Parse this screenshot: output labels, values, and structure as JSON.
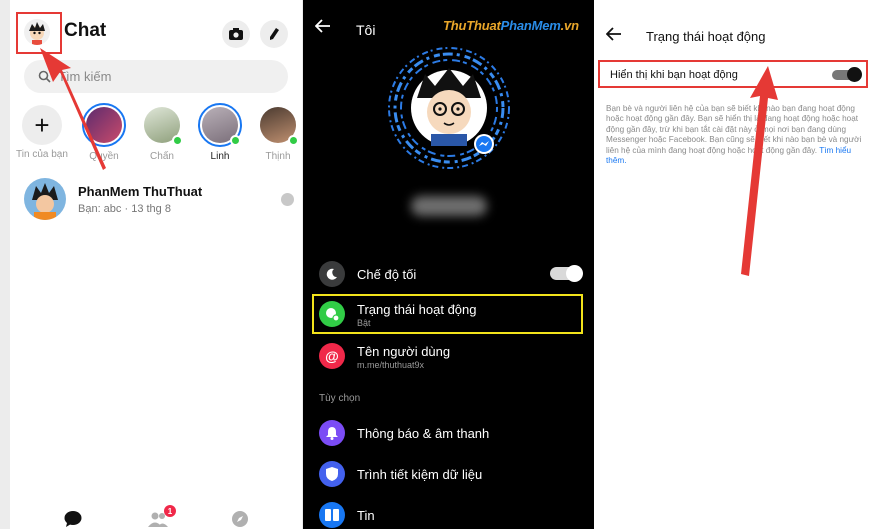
{
  "panel1": {
    "title": "Chat",
    "search_placeholder": "Tìm kiếm",
    "add_story_label": "Tin của bạn",
    "stories": [
      {
        "name": "Quyền",
        "active": false
      },
      {
        "name": "Chấn",
        "active": false
      },
      {
        "name": "Linh",
        "active": true
      },
      {
        "name": "Thịnh",
        "active": false
      }
    ],
    "conversation": {
      "name": "PhanMem ThuThuat",
      "subtitle": "Bạn: abc · 13 thg 8"
    },
    "nav_badge": "1",
    "icons": [
      "camera-icon",
      "pencil-icon",
      "search-icon",
      "plus-icon",
      "chat-bubble-icon",
      "people-icon",
      "compass-icon"
    ]
  },
  "panel2": {
    "title": "Tôi",
    "watermark_a": "ThuThuat",
    "watermark_b": "PhanMem",
    "watermark_c": ".vn",
    "rows": [
      {
        "label": "Chế độ tối",
        "sub": ""
      },
      {
        "label": "Trạng thái hoạt động",
        "sub": "Bật"
      },
      {
        "label": "Tên người dùng",
        "sub": "m.me/thuthuat9x"
      }
    ],
    "section": "Tùy chọn",
    "options": [
      {
        "label": "Thông báo & âm thanh"
      },
      {
        "label": "Trình tiết kiệm dữ liệu"
      },
      {
        "label": "Tin"
      }
    ],
    "colors": {
      "active_status": "#31cc46",
      "username": "#f02849",
      "notifications": "#7b4cf5",
      "data_saver": "#4361ee",
      "stories": "#1877f2"
    }
  },
  "panel3": {
    "title": "Trạng thái hoạt động",
    "toggle_label": "Hiển thị khi bạn hoạt động",
    "description": "Bạn bè và người liên hệ của bạn sẽ biết khi nào bạn đang hoạt động hoặc hoạt động gần đây. Bạn sẽ hiển thị là đang hoạt động hoặc hoạt động gần đây, trừ khi bạn tắt cài đặt này ở mọi nơi bạn đang dùng Messenger hoặc Facebook. Bạn cũng sẽ biết khi nào bạn bè và người liên hệ của mình đang hoạt động hoặc hoạt động gần đây.",
    "link": "Tìm hiểu thêm."
  }
}
